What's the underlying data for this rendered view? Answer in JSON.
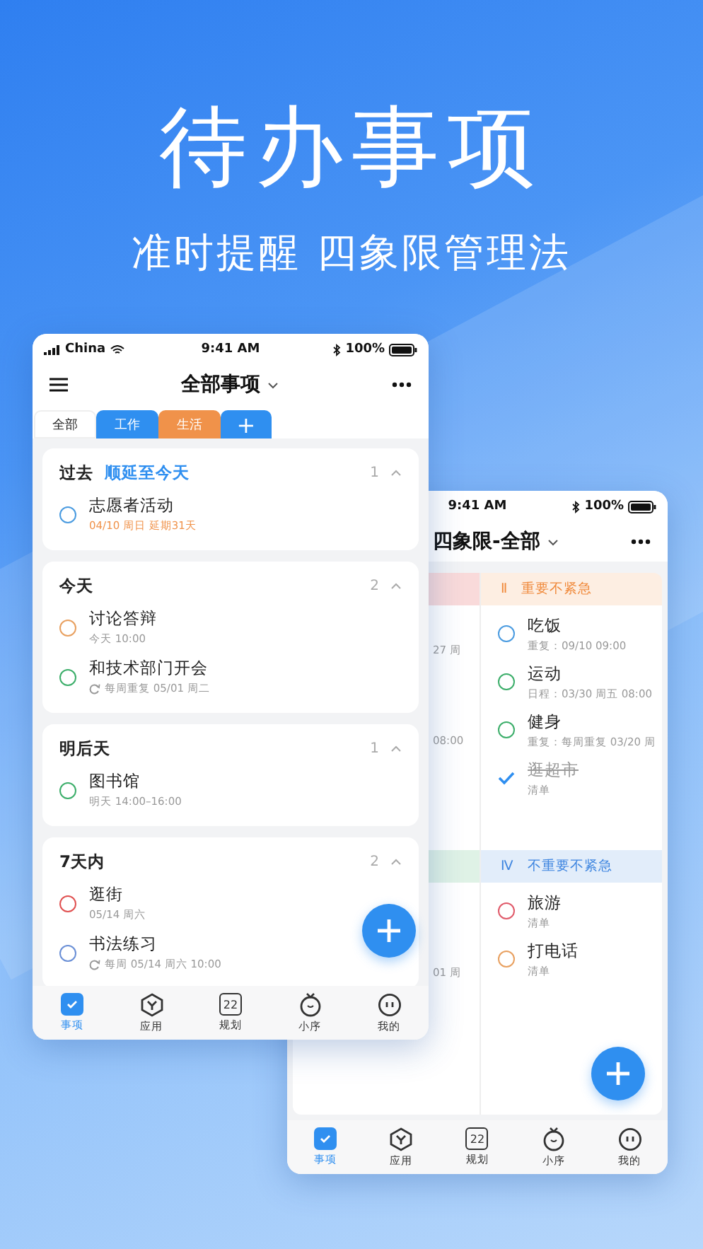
{
  "headline": "待办事项",
  "subheadline": "准时提醒 四象限管理法",
  "front_phone": {
    "status_bar": {
      "carrier": "China",
      "time": "9:41 AM",
      "battery": "100%"
    },
    "title": "全部事项",
    "tabs": [
      {
        "label": "全部",
        "selected": true,
        "color": "#ffffff"
      },
      {
        "label": "工作",
        "selected": false,
        "color": "#2f8ff0"
      },
      {
        "label": "生活",
        "selected": false,
        "color": "#f0924a"
      },
      {
        "label": "+",
        "selected": false,
        "color": "#2f8ff0"
      }
    ],
    "sections": [
      {
        "title": "过去",
        "action": "顺延至今天",
        "count": "1",
        "tasks": [
          {
            "title": "志愿者活动",
            "detail": "04/10 周日 延期31天",
            "color": "#4a9be0",
            "overdue": true,
            "repeat": false
          }
        ]
      },
      {
        "title": "今天",
        "count": "2",
        "tasks": [
          {
            "title": "讨论答辩",
            "detail": "今天 10:00",
            "color": "#e8a060",
            "overdue": false,
            "repeat": false
          },
          {
            "title": "和技术部门开会",
            "detail": "每周重复  05/01 周二",
            "color": "#3cae6a",
            "overdue": false,
            "repeat": true
          }
        ]
      },
      {
        "title": "明后天",
        "count": "1",
        "tasks": [
          {
            "title": "图书馆",
            "detail": "明天 14:00–16:00",
            "color": "#3cae6a",
            "overdue": false,
            "repeat": false
          }
        ]
      },
      {
        "title": "7天内",
        "count": "2",
        "tasks": [
          {
            "title": "逛街",
            "detail": "05/14  周六",
            "color": "#e05050",
            "overdue": false,
            "repeat": false
          },
          {
            "title": "书法练习",
            "detail": "每周  05/14 周六 10:00",
            "color": "#6a8fd6",
            "overdue": false,
            "repeat": true
          }
        ]
      }
    ],
    "tab_bar": [
      {
        "label": "事项",
        "kind": "check",
        "selected": true
      },
      {
        "label": "应用",
        "kind": "hex",
        "selected": false
      },
      {
        "label": "规划",
        "kind": "calendar",
        "icon_text": "22",
        "selected": false
      },
      {
        "label": "小序",
        "kind": "timer",
        "selected": false
      },
      {
        "label": "我的",
        "kind": "face",
        "selected": false
      }
    ]
  },
  "back_phone": {
    "status_bar": {
      "time": "9:41 AM",
      "battery": "100%"
    },
    "title": "四象限-全部",
    "left_quadrants": [
      {
        "color": "#f9dada",
        "fragments": [
          "27 周",
          "08:00"
        ]
      },
      {
        "color": "#dff2e6",
        "fragments": [
          "01 周"
        ]
      }
    ],
    "quadrants": [
      {
        "numeral": "Ⅱ",
        "title": "重要不紧急",
        "color": "#f08a3c",
        "tasks": [
          {
            "title": "吃饭",
            "detail": "重复：09/10 09:00",
            "color": "#4a9be0",
            "done": false
          },
          {
            "title": "运动",
            "detail": "日程：03/30 周五 08:00",
            "color": "#3cae6a",
            "done": false
          },
          {
            "title": "健身",
            "detail": "重复：每周重复 03/20 周",
            "color": "#3cae6a",
            "done": false
          },
          {
            "title": "逛超市",
            "detail": "清单",
            "color": "#2f8ff0",
            "done": true
          }
        ]
      },
      {
        "numeral": "Ⅳ",
        "title": "不重要不紧急",
        "color": "#3f86e0",
        "tasks": [
          {
            "title": "旅游",
            "detail": "清单",
            "color": "#e05a6a",
            "done": false
          },
          {
            "title": "打电话",
            "detail": "清单",
            "color": "#e8a060",
            "done": false
          }
        ]
      }
    ],
    "tab_bar": [
      {
        "label": "事项",
        "kind": "check",
        "selected": true
      },
      {
        "label": "应用",
        "kind": "hex",
        "selected": false
      },
      {
        "label": "规划",
        "kind": "calendar",
        "icon_text": "22",
        "selected": false
      },
      {
        "label": "小序",
        "kind": "timer",
        "selected": false
      },
      {
        "label": "我的",
        "kind": "face",
        "selected": false
      }
    ]
  }
}
